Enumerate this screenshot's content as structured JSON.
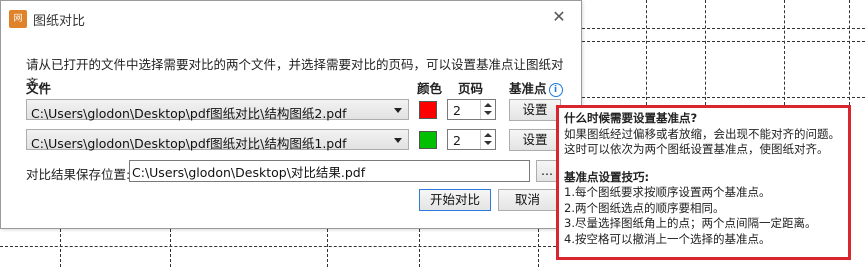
{
  "colors": {
    "accent": "#2c7be0",
    "red_swatch": "#ff0000",
    "green_swatch": "#00c000",
    "tooltip_border": "#d9262e"
  },
  "dialog": {
    "title": "图纸对比",
    "app_icon_text": "网",
    "close_glyph": "✕",
    "instruction": "请从已打开的文件中选择需要对比的两个文件，并选择需要对比的页码，可以设置基准点让图纸对齐。",
    "headers": {
      "file": "文件",
      "color": "颜色",
      "page": "页码",
      "base_point": "基准点"
    },
    "info_icon": "i",
    "rows": [
      {
        "file": "C:\\Users\\glodon\\Desktop\\pdf图纸对比\\结构图纸2.pdf",
        "color": "#ff0000",
        "page": "2",
        "set_label": "设置"
      },
      {
        "file": "C:\\Users\\glodon\\Desktop\\pdf图纸对比\\结构图纸1.pdf",
        "color": "#00c000",
        "page": "2",
        "set_label": "设置"
      }
    ],
    "save_location_label": "对比结果保存位置:",
    "save_path": "C:\\Users\\glodon\\Desktop\\对比结果.pdf",
    "browse_label": "...",
    "start_label": "开始对比",
    "cancel_label": "取消"
  },
  "tooltip": {
    "q_title": "什么时候需要设置基准点?",
    "q_line1": "如果图纸经过偏移或者放缩，会出现不能对齐的问题。",
    "q_line2": "这时可以依次为两个图纸设置基准点，使图纸对齐。",
    "tips_title": "基准点设置技巧:",
    "tip1": "1.每个图纸要求按顺序设置两个基准点。",
    "tip2": "2.两个图纸选点的顺序要相同。",
    "tip3": "3.尽量选择图纸角上的点；两个点间隔一定距离。",
    "tip4": "4.按空格可以撤消上一个选择的基准点。"
  }
}
